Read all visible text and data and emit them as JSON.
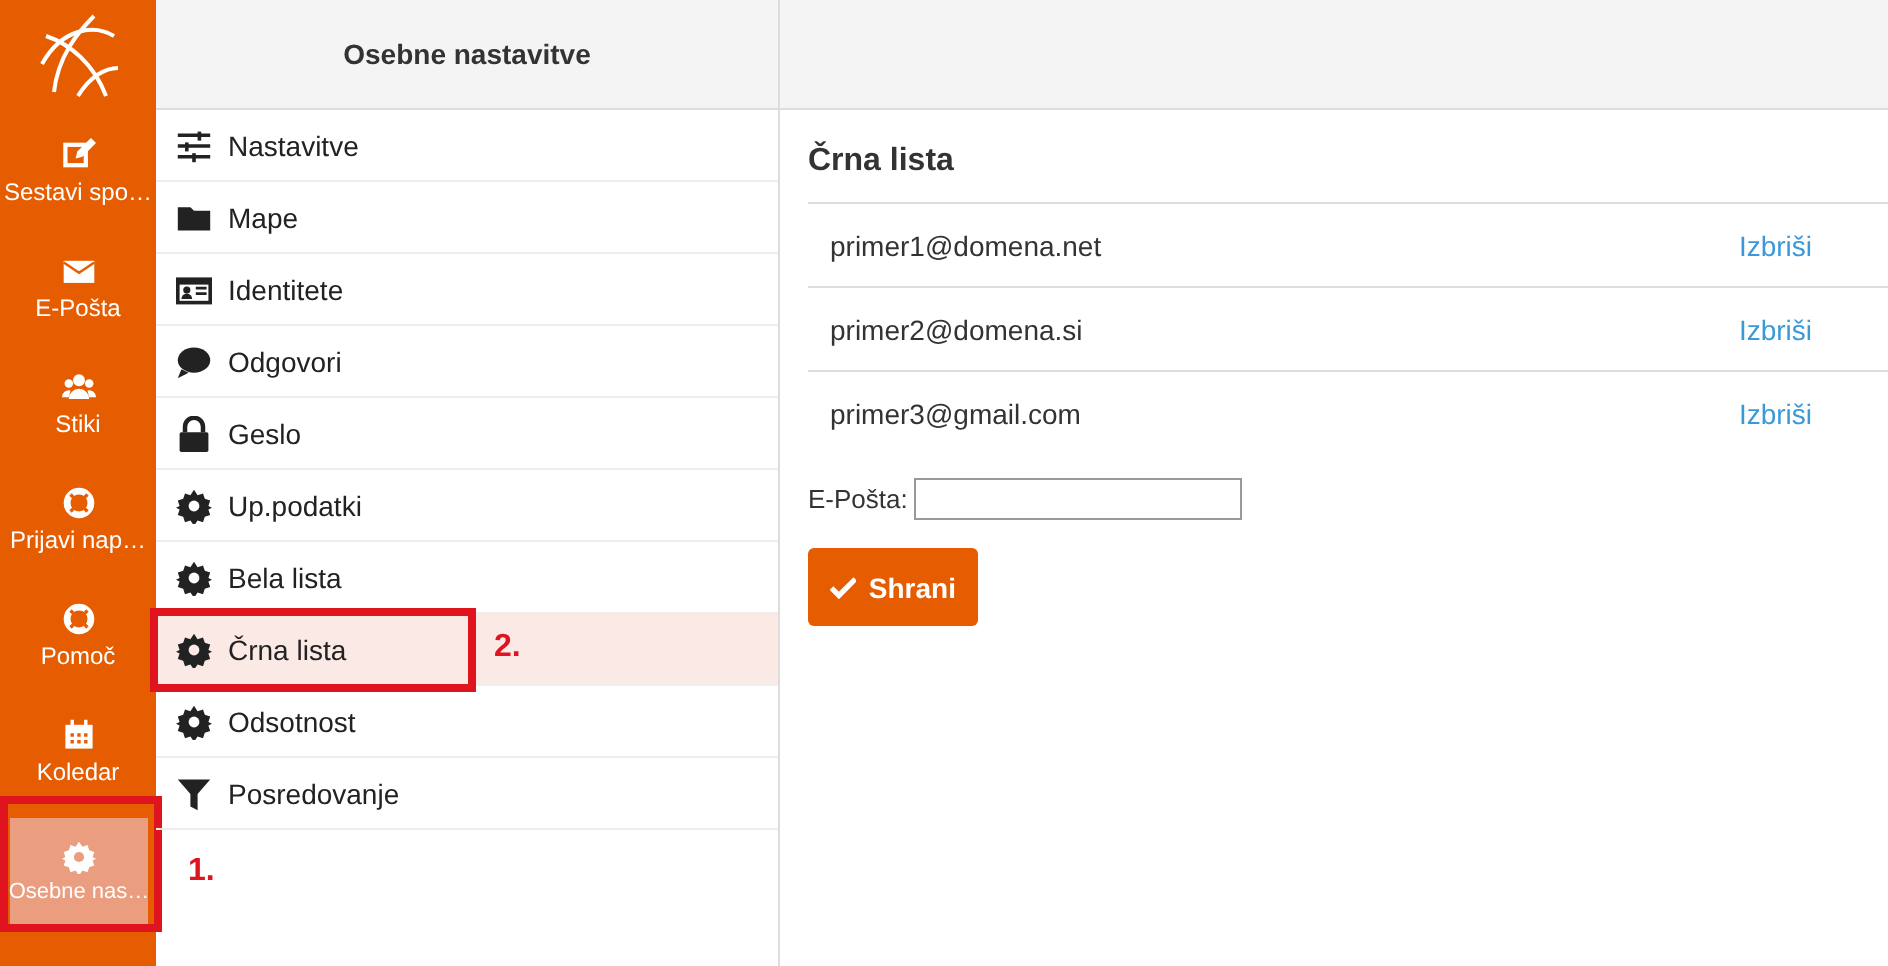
{
  "sidebar": {
    "items": [
      {
        "label": "Sestavi spo…",
        "selected": false
      },
      {
        "label": "E-Pošta",
        "selected": false
      },
      {
        "label": "Stiki",
        "selected": false
      },
      {
        "label": "Prijavi nap…",
        "selected": false
      },
      {
        "label": "Pomoč",
        "selected": false
      },
      {
        "label": "Koledar",
        "selected": false
      },
      {
        "label": "Osebne nas…",
        "selected": true,
        "callout": "1."
      }
    ]
  },
  "settings_menu": {
    "title": "Osebne nastavitve",
    "items": [
      {
        "label": "Nastavitve",
        "selected": false
      },
      {
        "label": "Mape",
        "selected": false
      },
      {
        "label": "Identitete",
        "selected": false
      },
      {
        "label": "Odgovori",
        "selected": false
      },
      {
        "label": "Geslo",
        "selected": false
      },
      {
        "label": "Up.podatki",
        "selected": false
      },
      {
        "label": "Bela lista",
        "selected": false
      },
      {
        "label": "Črna lista",
        "selected": true,
        "callout": "2."
      },
      {
        "label": "Odsotnost",
        "selected": false
      },
      {
        "label": "Posredovanje",
        "selected": false
      }
    ]
  },
  "panel": {
    "title": "Črna lista",
    "entries": [
      {
        "address": "primer1@domena.net",
        "action": "Izbriši"
      },
      {
        "address": "primer2@domena.si",
        "action": "Izbriši"
      },
      {
        "address": "primer3@gmail.com",
        "action": "Izbriši"
      }
    ],
    "field_label": "E-Pošta:",
    "save_button": "Shrani"
  }
}
